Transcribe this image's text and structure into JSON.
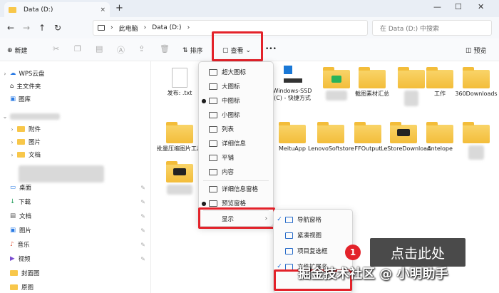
{
  "window": {
    "tab_title": "Data (D:)",
    "tab_close": "×",
    "new_tab": "+",
    "minimize": "—",
    "maximize": "☐",
    "close": "✕"
  },
  "address": {
    "crumb_pc": "此电脑",
    "crumb_drive": "Data (D:)",
    "search_placeholder": "在 Data (D:) 中搜索"
  },
  "toolbar": {
    "new_label": "新建",
    "sort_label": "排序",
    "view_label": "查看",
    "more_label": "•••",
    "preview_label": "预览"
  },
  "sidebar": {
    "wps": "WPS云盘",
    "home": "主文件夹",
    "gallery": "图库",
    "attach": "附件",
    "pictures_a": "图片",
    "docs_a": "文档",
    "desktop": "桌面",
    "downloads": "下载",
    "docs": "文档",
    "pictures": "图片",
    "music": "音乐",
    "videos": "视频",
    "cover": "封面图",
    "original": "原图"
  },
  "files": {
    "f1": "发布: .txt",
    "f2": "Windows-SSD (C) - 快捷方式",
    "f3": "截图素材汇总",
    "f4": "工作",
    "f5": "360Downloads",
    "f6": "批量压缩图片工具",
    "f7": "MeituApp",
    "f8": "LenovoSoftstore",
    "f9": "FFOutput",
    "f10": "LeStoreDownload",
    "f11": "Antelope"
  },
  "view_menu": {
    "extra_large": "超大图标",
    "large": "大图标",
    "medium": "中图标",
    "small": "小图标",
    "list": "列表",
    "details": "详细信息",
    "tiles": "平铺",
    "content": "内容",
    "details_pane": "详细信息窗格",
    "preview_pane": "预览窗格",
    "show": "显示"
  },
  "show_menu": {
    "nav_pane": "导航窗格",
    "compact": "紧凑视图",
    "checkboxes": "项目复选框",
    "extensions": "文件扩展名"
  },
  "annotation": {
    "badge": "1",
    "tooltip": "点击此处",
    "watermark": "掘金技术社区 @ 小明助手"
  },
  "colors": {
    "highlight": "#e3222a",
    "folder": "#f3bd3a",
    "accent": "#1a6bd6"
  }
}
